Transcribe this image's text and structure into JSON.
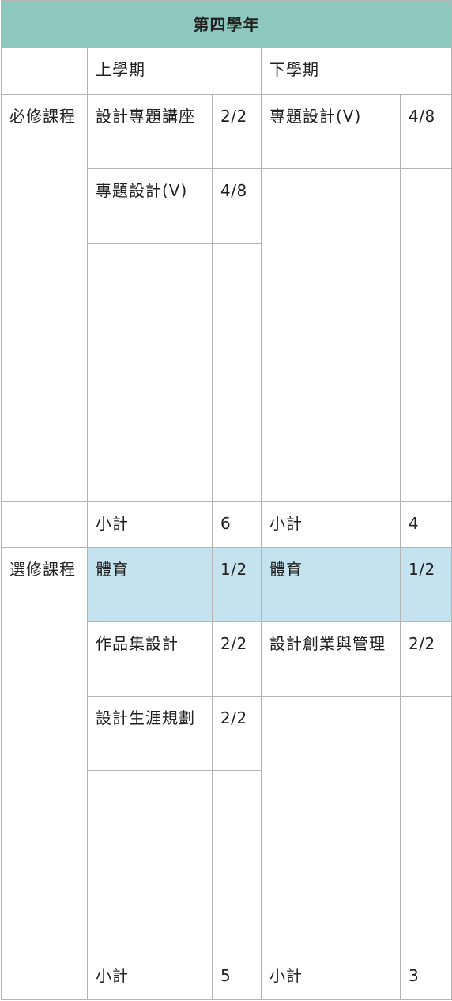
{
  "table": {
    "title": "第四學年",
    "semester_headers": {
      "first": "上學期",
      "second": "下學期"
    },
    "required": {
      "category": "必修課程",
      "first": [
        {
          "name": "設計專題講座",
          "credits": "2/2"
        },
        {
          "name": "專題設計(V)",
          "credits": "4/8"
        }
      ],
      "second": [
        {
          "name": "專題設計(V)",
          "credits": "4/8"
        }
      ],
      "subtotal": {
        "label_first": "小計",
        "value_first": "6",
        "label_second": "小計",
        "value_second": "4"
      }
    },
    "elective": {
      "category": "選修課程",
      "first": [
        {
          "name": "體育",
          "credits": "1/2"
        },
        {
          "name": "作品集設計",
          "credits": "2/2"
        },
        {
          "name": "設計生涯規劃",
          "credits": "2/2"
        }
      ],
      "second": [
        {
          "name": "體育",
          "credits": "1/2"
        },
        {
          "name": "設計創業與管理",
          "credits": "2/2"
        }
      ],
      "subtotal": {
        "label_first": "小計",
        "value_first": "5",
        "label_second": "小計",
        "value_second": "3"
      }
    },
    "colors": {
      "header_bg": "#8ec7bd",
      "highlight_bg": "#c5e3ef",
      "border": "#b4b4b4",
      "text": "#222222"
    }
  }
}
